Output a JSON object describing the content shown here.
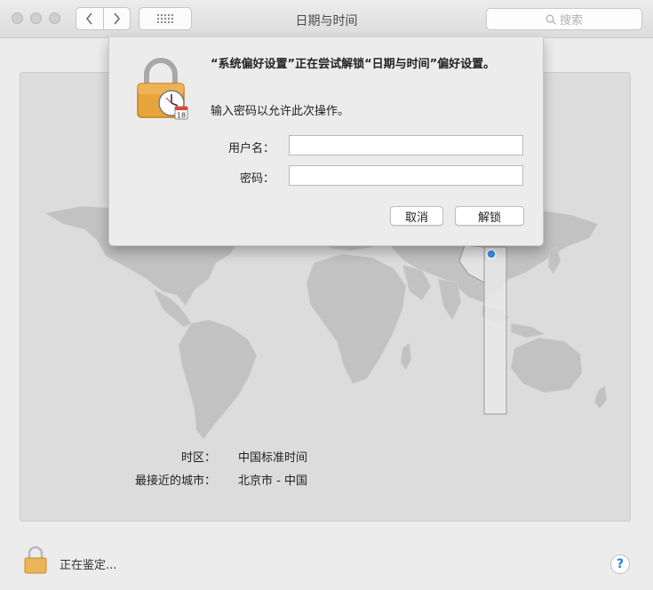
{
  "window": {
    "title": "日期与时间",
    "search_placeholder": "搜索"
  },
  "dialog": {
    "title": "“系统偏好设置”正在尝试解锁“日期与时间”偏好设置。",
    "message": "输入密码以允许此次操作。",
    "username_label": "用户名：",
    "username_value": "",
    "password_label": "密码：",
    "password_value": "",
    "cancel_label": "取消",
    "unlock_label": "解锁",
    "icon_calendar_day": "18"
  },
  "timezone": {
    "tz_label": "时区：",
    "tz_value": "中国标准时间",
    "city_label": "最接近的城市：",
    "city_value": "北京市 - 中国"
  },
  "footer": {
    "status": "正在鉴定...",
    "help": "?"
  },
  "colors": {
    "accent": "#2f7ad8",
    "lock_gold": "#e7a43a",
    "map_land": "#bfbfbf"
  }
}
